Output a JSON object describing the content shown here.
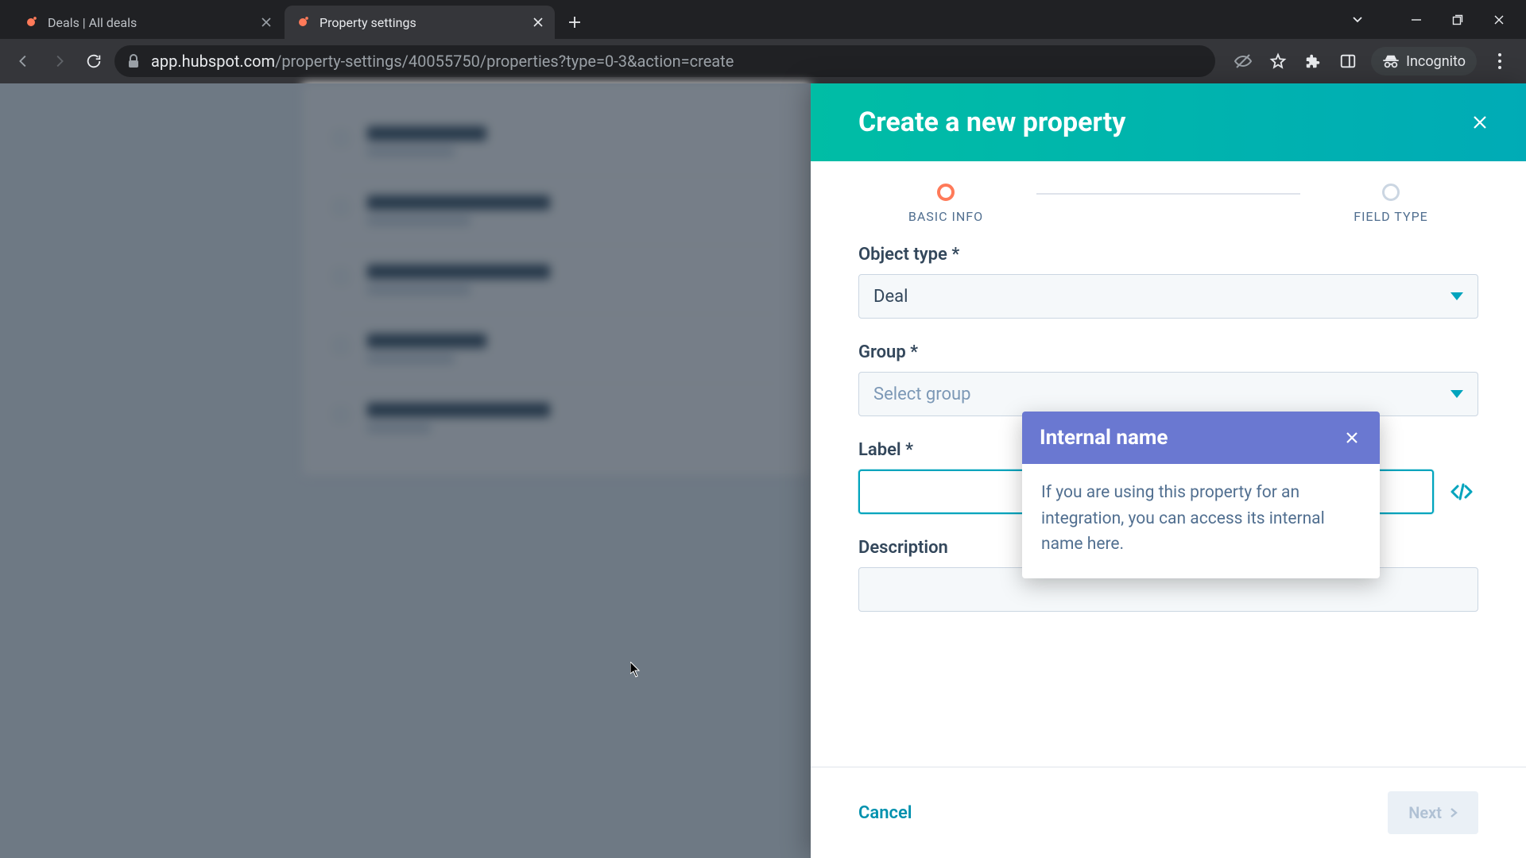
{
  "browser": {
    "tabs": [
      {
        "title": "Deals | All deals",
        "active": false
      },
      {
        "title": "Property settings",
        "active": true
      }
    ],
    "url_host": "app.hubspot.com",
    "url_path": "/property-settings/40055750/properties?type=0-3&action=create",
    "incognito_label": "Incognito"
  },
  "drawer": {
    "title": "Create a new property",
    "steps": {
      "basic_info": "BASIC INFO",
      "field_type": "FIELD TYPE"
    },
    "fields": {
      "object_type_label": "Object type *",
      "object_type_value": "Deal",
      "group_label": "Group *",
      "group_placeholder": "Select group",
      "label_label": "Label *",
      "label_value": "",
      "description_label": "Description",
      "description_value": ""
    },
    "popover": {
      "title": "Internal name",
      "body": "If you are using this property for an integration, you can access its internal name here."
    },
    "footer": {
      "cancel": "Cancel",
      "next": "Next"
    }
  }
}
